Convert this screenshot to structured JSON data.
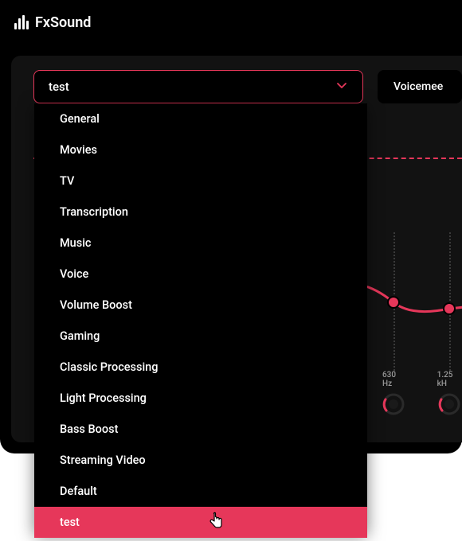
{
  "app_name": "FxSound",
  "preset": {
    "selected": "test",
    "options": [
      "General",
      "Movies",
      "TV",
      "Transcription",
      "Music",
      "Voice",
      "Volume Boost",
      "Gaming",
      "Classic Processing",
      "Light Processing",
      "Bass Boost",
      "Streaming Video",
      "Default",
      "test"
    ],
    "selected_index": 13
  },
  "output": {
    "label": "Voicemee"
  },
  "eq": {
    "bands": [
      {
        "label": "630 Hz"
      },
      {
        "label": "1.25 kH"
      }
    ]
  },
  "colors": {
    "accent": "#e6375a",
    "bg": "#000",
    "panel": "#121212"
  }
}
